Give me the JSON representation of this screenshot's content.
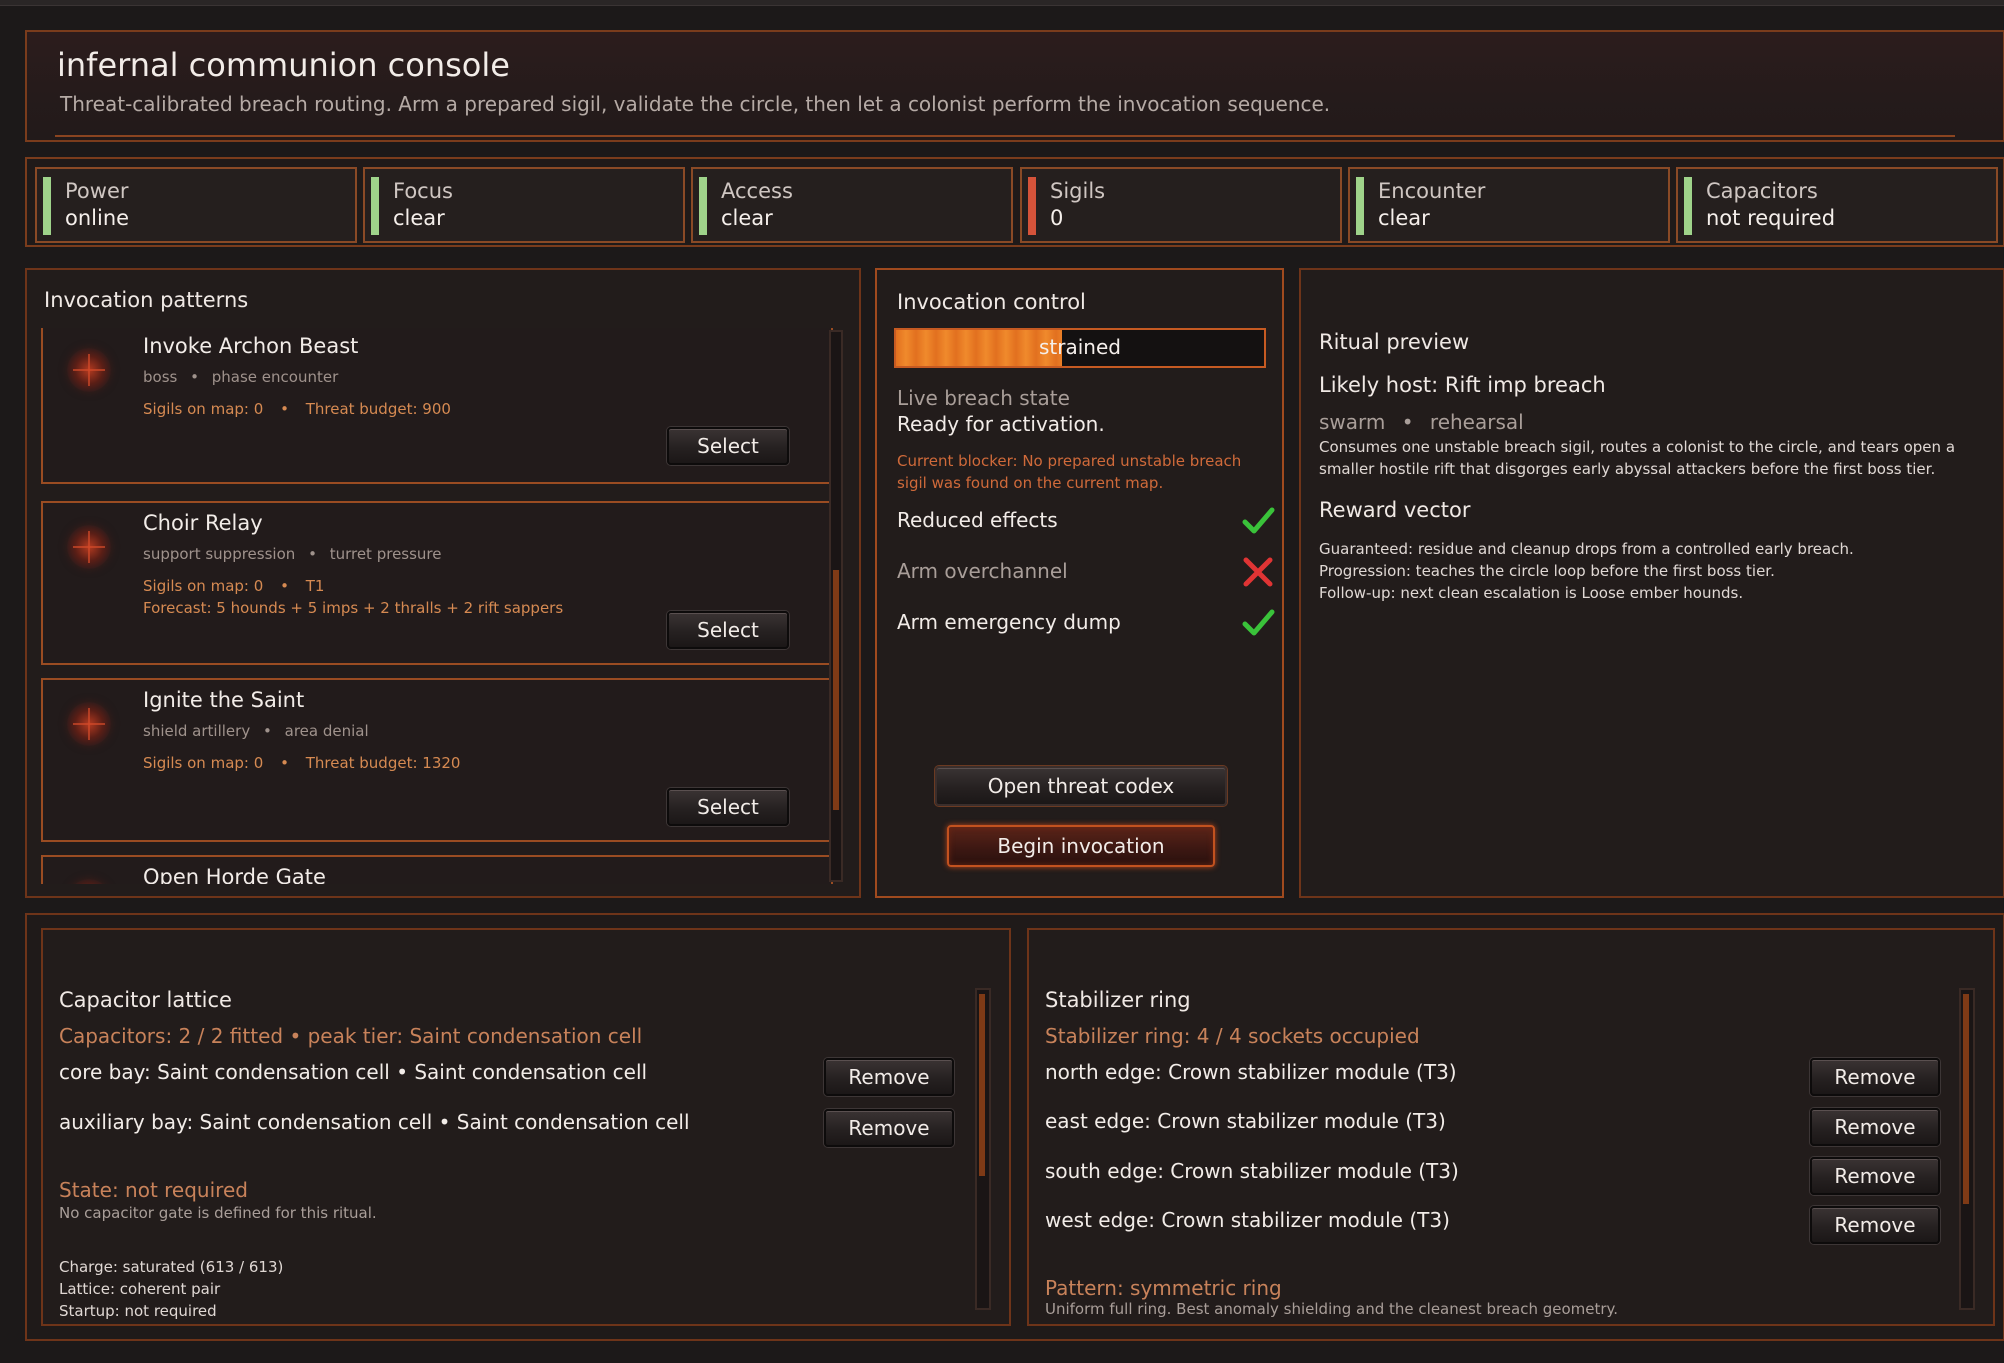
{
  "header": {
    "title": "infernal communion console",
    "subtitle": "Threat-calibrated breach routing. Arm a prepared sigil, validate the circle, then let a colonist perform the invocation sequence."
  },
  "stats": [
    {
      "label": "Power",
      "value": "online",
      "color": "#9fd38a"
    },
    {
      "label": "Focus",
      "value": "clear",
      "color": "#9fd38a"
    },
    {
      "label": "Access",
      "value": "clear",
      "color": "#9fd38a"
    },
    {
      "label": "Sigils",
      "value": "0",
      "color": "#d5533a"
    },
    {
      "label": "Encounter",
      "value": "clear",
      "color": "#9fd38a"
    },
    {
      "label": "Capacitors",
      "value": "not required",
      "color": "#9fd38a"
    }
  ],
  "patterns": {
    "title": "Invocation patterns",
    "select_label": "Select",
    "items": [
      {
        "name": "Invoke Archon Beast",
        "tag1": "boss",
        "tag2": "phase encounter",
        "meta1": "Sigils on map: 0",
        "meta2": "Threat budget: 900",
        "forecast": ""
      },
      {
        "name": "Choir Relay",
        "tag1": "support suppression",
        "tag2": "turret pressure",
        "meta1": "Sigils on map: 0",
        "meta2": "T1",
        "forecast": "Forecast: 5 hounds + 5 imps + 2 thralls + 2 rift sappers"
      },
      {
        "name": "Ignite the Saint",
        "tag1": "shield artillery",
        "tag2": "area denial",
        "meta1": "Sigils on map: 0",
        "meta2": "Threat budget: 1320",
        "forecast": ""
      },
      {
        "name": "Open Horde Gate"
      }
    ]
  },
  "control": {
    "title": "Invocation control",
    "progress_label": "strained",
    "progress_fraction": 0.45,
    "state_label": "Live breach state",
    "state_value": "Ready for activation.",
    "blocker_line1": "Current blocker: No prepared unstable breach",
    "blocker_line2": "sigil was found on the current map.",
    "options": [
      {
        "label": "Reduced effects",
        "enabled": true
      },
      {
        "label": "Arm overchannel",
        "enabled": false
      },
      {
        "label": "Arm emergency dump",
        "enabled": true
      }
    ],
    "codex_button": "Open threat codex",
    "begin_button": "Begin invocation"
  },
  "preview": {
    "title": "Ritual preview",
    "host": "Likely host: Rift imp breach",
    "tag1": "swarm",
    "tag2": "rehearsal",
    "desc1": "Consumes one unstable breach sigil, routes a colonist to the circle, and tears open a",
    "desc2": "smaller hostile rift that disgorges early abyssal attackers before the first boss tier.",
    "reward_title": "Reward vector",
    "reward1": "Guaranteed: residue and cleanup drops from a controlled early breach.",
    "reward2": "Progression: teaches the circle loop before the first boss tier.",
    "reward3": "Follow-up: next clean escalation is Loose ember hounds."
  },
  "capacitor": {
    "title": "Capacitor lattice",
    "summary": "Capacitors: 2 / 2 fitted • peak tier: Saint condensation cell",
    "rows": [
      "core bay: Saint condensation cell • Saint condensation cell",
      "auxiliary bay: Saint condensation cell • Saint condensation cell"
    ],
    "remove_label": "Remove",
    "state": "State: not required",
    "state_note": "No capacitor gate is defined for this ritual.",
    "charge": "Charge: saturated (613 / 613)",
    "lattice": "Lattice: coherent pair",
    "startup": "Startup: not required"
  },
  "stabilizer": {
    "title": "Stabilizer ring",
    "summary": "Stabilizer ring: 4 / 4 sockets occupied",
    "rows": [
      "north edge: Crown stabilizer module (T3)",
      "east edge: Crown stabilizer module (T3)",
      "south edge: Crown stabilizer module (T3)",
      "west edge: Crown stabilizer module (T3)"
    ],
    "remove_label": "Remove",
    "pattern": "Pattern: symmetric ring",
    "pattern_note": "Uniform full ring. Best anomaly shielding and the cleanest breach geometry."
  }
}
